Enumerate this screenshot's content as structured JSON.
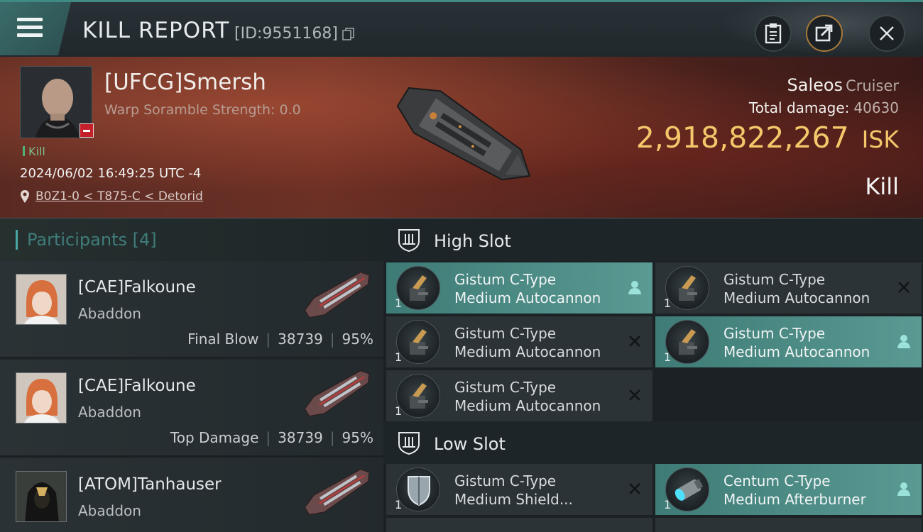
{
  "header": {
    "title": "KILL REPORT",
    "report_id": "[ID:9551168]"
  },
  "victim": {
    "name": "[UFCG]Smersh",
    "warp": "Warp Soramble Strength: 0.0",
    "tag": "Kill",
    "date": "2024/06/02 16:49:25 UTC -4",
    "location": "B0Z1-0 < T875-C < Detorid",
    "ship_name": "Saleos",
    "ship_class": "Cruiser",
    "total_damage_label": "Total damage:",
    "total_damage": "40630",
    "isk_value": "2,918,822,267",
    "isk_unit": "ISK",
    "result": "Kill"
  },
  "participants": {
    "title": "Participants [4]",
    "rows": [
      {
        "name": "[CAE]Falkoune",
        "ship": "Abaddon",
        "role": "Final Blow",
        "damage": "38739",
        "pct": "95%"
      },
      {
        "name": "[CAE]Falkoune",
        "ship": "Abaddon",
        "role": "Top Damage",
        "damage": "38739",
        "pct": "95%"
      },
      {
        "name": "[ATOM]Tanhauser",
        "ship": "Abaddon"
      }
    ]
  },
  "fitting": {
    "high_slot_label": "High Slot",
    "low_slot_label": "Low Slot",
    "high": [
      {
        "line1": "Gistum C-Type",
        "line2": "Medium Autocannon",
        "qty": "1",
        "state": "person-icon"
      },
      {
        "line1": "Gistum C-Type",
        "line2": "Medium Autocannon",
        "qty": "1",
        "state": "x-icon"
      },
      {
        "line1": "Gistum C-Type",
        "line2": "Medium Autocannon",
        "qty": "1",
        "state": "x-icon"
      },
      {
        "line1": "Gistum C-Type",
        "line2": "Medium Autocannon",
        "qty": "1",
        "state": "person-icon"
      },
      {
        "line1": "Gistum C-Type",
        "line2": "Medium Autocannon",
        "qty": "1",
        "state": "x-icon"
      }
    ],
    "low": [
      {
        "line1": "Gistum C-Type",
        "line2": "Medium Shield...",
        "qty": "1",
        "state": "x-icon"
      },
      {
        "line1": "Centum C-Type",
        "line2": "Medium Afterburner",
        "qty": "1",
        "state": "person-icon"
      }
    ]
  },
  "colors": {
    "accent_teal": "#4aa8a4",
    "isk_gold": "#f3c76a",
    "highlight_row": "#4a8a84",
    "corp_badge_red": "#c4202a"
  }
}
